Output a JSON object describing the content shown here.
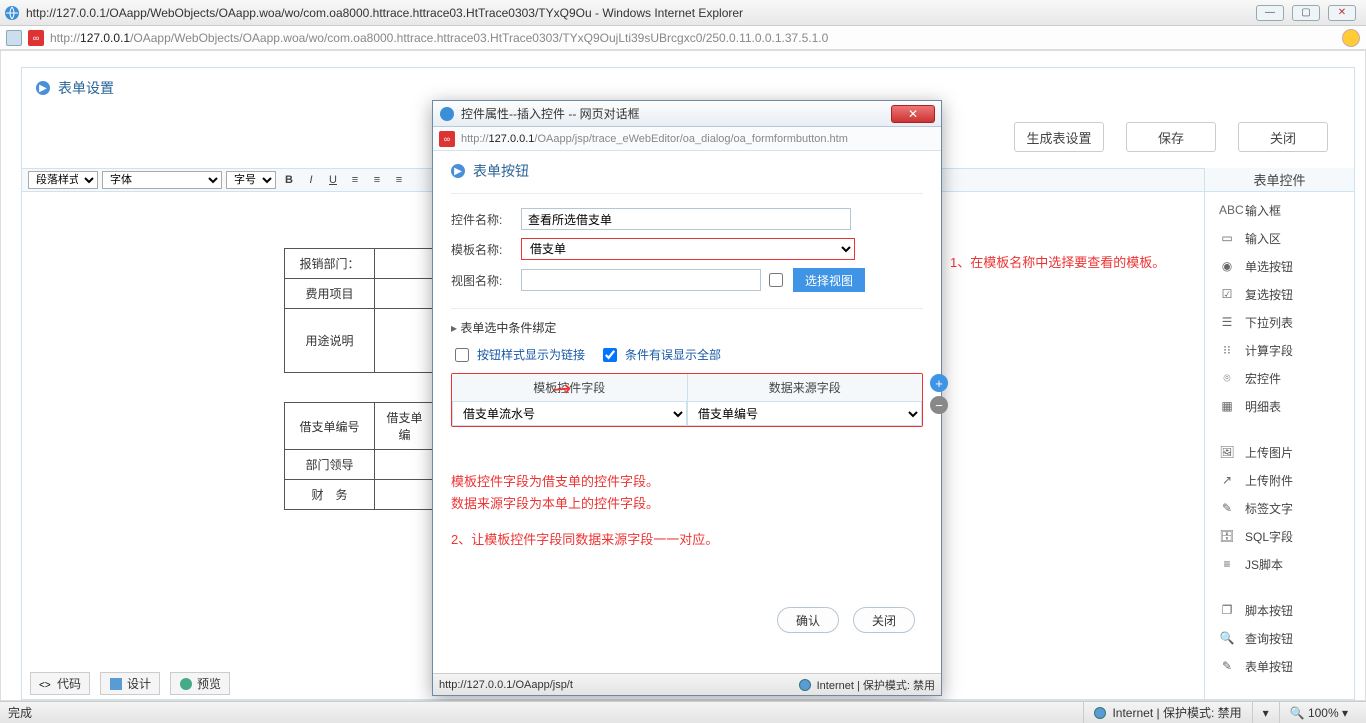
{
  "browser": {
    "title": "http://127.0.0.1/OAapp/WebObjects/OAapp.woa/wo/com.oa8000.httrace.httrace03.HtTrace0303/TYxQ9Ou - Windows Internet Explorer",
    "url_plain_pre": "http://",
    "url_bold": "127.0.0.1",
    "url_plain_post": "/OAapp/WebObjects/OAapp.woa/wo/com.oa8000.httrace.httrace03.HtTrace0303/TYxQ9OujLti39sUBrcgxc0/250.0.11.0.0.1.37.5.1.0"
  },
  "page": {
    "section_title": "表单设置",
    "actions": {
      "gen": "生成表设置",
      "save": "保存",
      "close": "关闭"
    },
    "toolbar": {
      "para": "段落样式",
      "font": "字体",
      "size": "字号"
    },
    "form_rows": [
      {
        "label": "报销部门："
      },
      {
        "label": "费用项目"
      },
      {
        "label": "用途说明"
      },
      {
        "label": "借支单编号",
        "value": "借支单编"
      },
      {
        "label": "部门领导"
      },
      {
        "label": "财　务"
      }
    ],
    "tabs": {
      "code": "代码",
      "design": "设计",
      "preview": "预览"
    }
  },
  "palette": {
    "title": "表单控件",
    "items1": [
      {
        "icon": "ABC",
        "label": "输入框"
      },
      {
        "icon": "▭",
        "label": "输入区"
      },
      {
        "icon": "◉",
        "label": "单选按钮"
      },
      {
        "icon": "☑",
        "label": "复选按钮"
      },
      {
        "icon": "☰",
        "label": "下拉列表"
      },
      {
        "icon": "⁝⁝",
        "label": "计算字段"
      },
      {
        "icon": "⌾",
        "label": "宏控件"
      },
      {
        "icon": "▦",
        "label": "明细表"
      }
    ],
    "items2": [
      {
        "icon": "🖼",
        "label": "上传图片"
      },
      {
        "icon": "↗",
        "label": "上传附件"
      },
      {
        "icon": "✎",
        "label": "标签文字"
      },
      {
        "icon": "🗄",
        "label": "SQL字段"
      },
      {
        "icon": "≡",
        "label": "JS脚本"
      }
    ],
    "items3": [
      {
        "icon": "❐",
        "label": "脚本按钮"
      },
      {
        "icon": "🔍",
        "label": "查询按钮"
      },
      {
        "icon": "✎",
        "label": "表单按钮"
      }
    ]
  },
  "dialog": {
    "title": "控件属性--插入控件 -- 网页对话框",
    "url_pre": "http://",
    "url_bold": "127.0.0.1",
    "url_post": "/OAapp/jsp/trace_eWebEditor/oa_dialog/oa_formformbutton.htm",
    "section": "表单按钮",
    "ctrl_name_label": "控件名称:",
    "ctrl_name_value": "查看所选借支单",
    "tpl_name_label": "模板名称:",
    "tpl_name_value": "借支单",
    "view_name_label": "视图名称:",
    "view_btn": "选择视图",
    "bind_title": "表单选中条件绑定",
    "opt_link": "按钮样式显示为链接",
    "opt_err": "条件有误显示全部",
    "col_tpl": "模板控件字段",
    "col_src": "数据来源字段",
    "row_tpl": "借支单流水号",
    "row_src": "借支单编号",
    "hint1": "模板控件字段为借支单的控件字段。",
    "hint2": "数据来源字段为本单上的控件字段。",
    "hint3": "2、让模板控件字段同数据来源字段一一对应。",
    "ok": "确认",
    "cancel": "关闭",
    "status_url": "http://127.0.0.1/OAapp/jsp/t",
    "status_zone": "Internet | 保护模式: 禁用"
  },
  "statusbar": {
    "done": "完成",
    "zone": "Internet | 保护模式: 禁用",
    "zoom": "100%"
  },
  "annotations": {
    "a1": "1、在模板名称中选择要查看的模板。",
    "arrow": "⟵"
  }
}
